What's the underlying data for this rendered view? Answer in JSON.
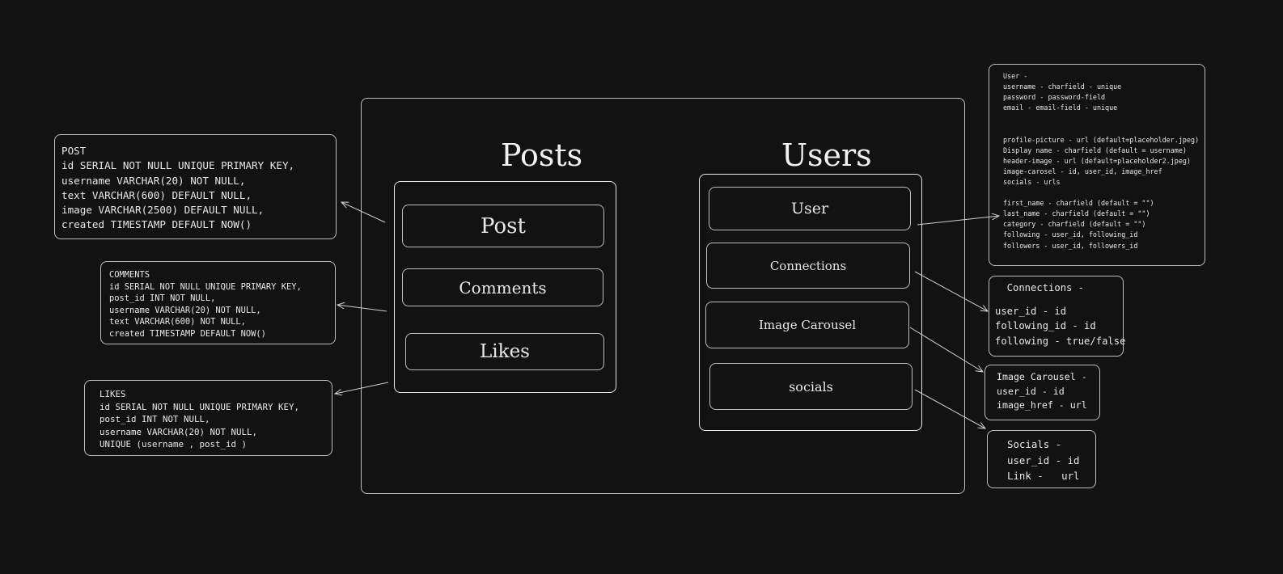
{
  "posts": {
    "title": "Posts",
    "items": [
      "Post",
      "Comments",
      "Likes"
    ]
  },
  "users": {
    "title": "Users",
    "items": [
      "User",
      "Connections",
      "Image Carousel",
      "socials"
    ]
  },
  "post_note": {
    "lines": [
      "POST",
      "id SERIAL NOT NULL UNIQUE PRIMARY KEY,",
      "username VARCHAR(20) NOT NULL,",
      "text VARCHAR(600) DEFAULT NULL,",
      "image VARCHAR(2500) DEFAULT NULL,",
      "created TIMESTAMP DEFAULT NOW()"
    ]
  },
  "comments_note": {
    "lines": [
      "COMMENTS",
      "id SERIAL NOT NULL UNIQUE PRIMARY KEY,",
      "post_id INT NOT NULL,",
      "username VARCHAR(20) NOT NULL,",
      "text VARCHAR(600) NOT NULL,",
      "created TIMESTAMP DEFAULT NOW()"
    ]
  },
  "likes_note": {
    "lines": [
      "LIKES",
      "id SERIAL NOT NULL UNIQUE PRIMARY KEY,",
      "post_id INT NOT NULL,",
      "username VARCHAR(20) NOT NULL,",
      "UNIQUE (username , post_id )"
    ]
  },
  "user_note": {
    "lines": [
      "User -",
      "username - charfield - unique",
      "password - password-field",
      "email - email-field - unique",
      "",
      "",
      "profile-picture - url (default=placeholder.jpeg)",
      "Display name - charfield (default = username)",
      "header-image - url (default=placeholder2.jpeg)",
      "image-carosel - id, user_id, image_href",
      "socials - urls",
      "",
      "first_name - charfield (default = \"\")",
      "last_name - charfield (default = \"\")",
      "category - charfield (default = \"\")",
      "following - user_id, following_id",
      "followers - user_id, followers_id"
    ]
  },
  "connections_note": {
    "lines": [
      "  Connections -",
      "",
      "user_id - id",
      "following_id - id",
      "following - true/false"
    ]
  },
  "carousel_note": {
    "lines": [
      "Image Carousel -",
      "user_id - id",
      "image_href - url"
    ]
  },
  "socials_note": {
    "lines": [
      "Socials -",
      "user_id - id",
      "Link -   url"
    ]
  }
}
